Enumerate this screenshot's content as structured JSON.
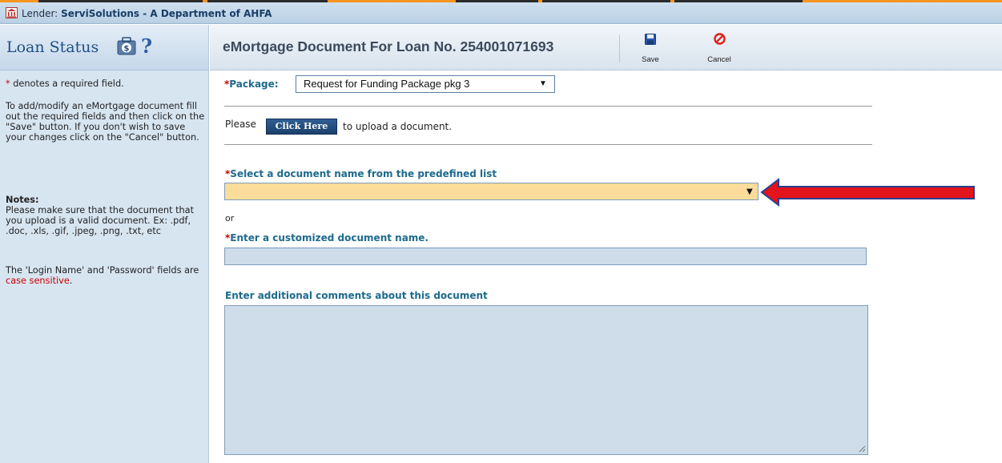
{
  "lender": {
    "label": "Lender:",
    "name": "ServiSolutions - A Department of AHFA"
  },
  "sidebar": {
    "title": "Loan Status",
    "help": "?",
    "required_note_star": "*",
    "required_note": "denotes a required field.",
    "instructions": "To add/modify an eMortgage document fill out the required fields and then click on the \"Save\" button. If you don't wish to save your changes click on the \"Cancel\" button.",
    "notes_heading": "Notes:",
    "notes_text": "Please make sure that the document that you upload is a valid document. Ex: .pdf, .doc, .xls, .gif, .jpeg, .png, .txt, etc",
    "case_text_prefix": "The 'Login Name' and 'Password' fields are",
    "case_text_red": "case sensitive",
    "case_text_suffix": "."
  },
  "header": {
    "title": "eMortgage Document For Loan No. 254001071693",
    "save_label": "Save",
    "cancel_label": "Cancel"
  },
  "form": {
    "package_star": "*",
    "package_label": "Package:",
    "package_value": "Request for Funding Package pkg 3",
    "please": "Please",
    "click_here": "Click Here",
    "upload_text": "to upload a document.",
    "doc_select_star": "*",
    "doc_select_label": "Select a document name from the predefined list",
    "doc_select_value": "",
    "or": "or",
    "custom_name_star": "*",
    "custom_name_label": "Enter a customized document name.",
    "custom_name_value": "",
    "comments_label": "Enter additional comments about this document",
    "comments_value": ""
  },
  "colors": {
    "accent_orange": "#f7941d",
    "label_teal": "#1d6a8c",
    "required_red": "#cc0000",
    "highlight_select": "#fbdc9a",
    "arrow_red": "#e2141c",
    "arrow_outline": "#2a3f8f"
  },
  "icons": {
    "bank": "bank-icon",
    "dollar": "dollar-bag-icon",
    "save": "floppy-disk-icon",
    "cancel": "no-entry-icon",
    "dropdown": "triangle-down-icon",
    "annotation": "red-arrow-icon"
  }
}
